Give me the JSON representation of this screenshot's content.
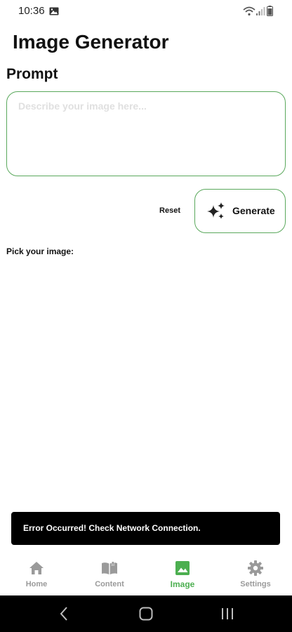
{
  "status_bar": {
    "time": "10:36"
  },
  "header": {
    "title": "Image Generator"
  },
  "prompt": {
    "heading": "Prompt",
    "value": "",
    "placeholder": "Describe your image here..."
  },
  "actions": {
    "reset_label": "Reset",
    "generate_label": "Generate"
  },
  "pick": {
    "label": "Pick your image:"
  },
  "snackbar": {
    "message": "Error Occurred! Check Network Connection."
  },
  "bottom_nav": {
    "items": [
      {
        "label": "Home",
        "icon": "home-icon"
      },
      {
        "label": "Content",
        "icon": "book-icon"
      },
      {
        "label": "Image",
        "icon": "image-icon",
        "active": true
      },
      {
        "label": "Settings",
        "icon": "gear-icon"
      }
    ]
  },
  "colors": {
    "accent": "#4caf50",
    "border": "#5aa85c",
    "inactive": "#9a9a9a",
    "snackbar_bg": "#000000",
    "system_nav_bg": "#000000"
  }
}
